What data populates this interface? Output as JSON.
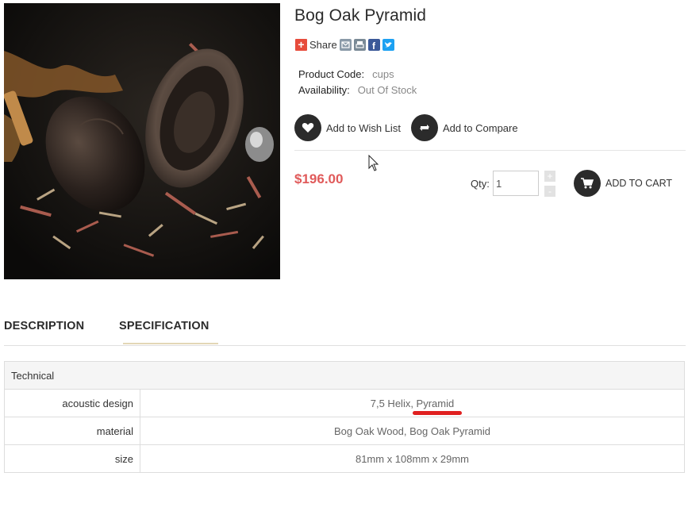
{
  "product": {
    "title": "Bog Oak Pyramid",
    "share_label": "Share",
    "share_icons": [
      "plus-icon",
      "email-icon",
      "print-icon",
      "facebook-icon",
      "twitter-icon"
    ],
    "product_code_label": "Product Code:",
    "product_code_value": "cups",
    "availability_label": "Availability:",
    "availability_value": "Out Of Stock",
    "wishlist_label": "Add to Wish List",
    "compare_label": "Add to Compare",
    "price": "$196.00",
    "qty_label": "Qty:",
    "qty_value": "1",
    "qty_plus": "+",
    "qty_minus": "-",
    "add_to_cart_label": "ADD TO CART"
  },
  "tabs": [
    {
      "label": "DESCRIPTION",
      "active": false
    },
    {
      "label": "SPECIFICATION",
      "active": true
    }
  ],
  "spec": {
    "group": "Technical",
    "rows": [
      {
        "label": "acoustic design",
        "value": "7,5 Helix, Pyramid"
      },
      {
        "label": "material",
        "value": "Bog Oak Wood, Bog Oak Pyramid"
      },
      {
        "label": "size",
        "value": "81mm x 108mm x 29mm"
      }
    ]
  },
  "colors": {
    "price": "#e05a5a",
    "dark_button": "#2b2b2b",
    "annotation_underline": "#e02020",
    "tab_active_underline": "#e3d7b6"
  }
}
